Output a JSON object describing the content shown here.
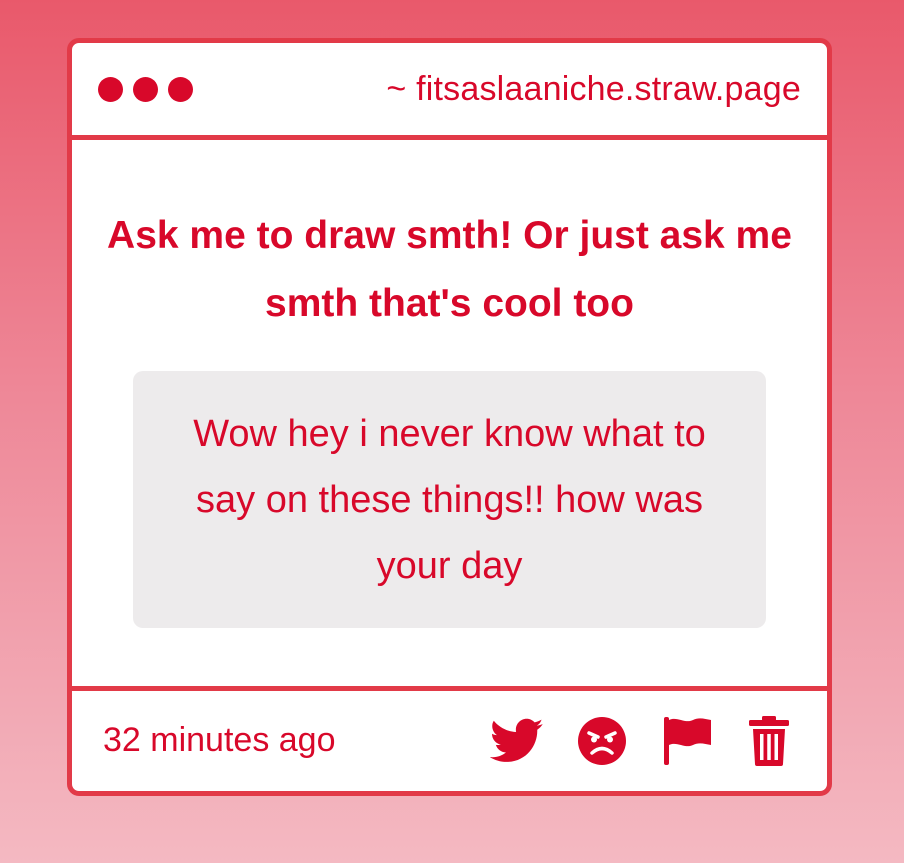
{
  "window": {
    "url": "~ fitsaslaaniche.straw.page"
  },
  "question": {
    "prompt": "Ask me to draw smth! Or just ask me smth that's cool too",
    "message": "Wow hey i never know what to say on these things!! how was your day"
  },
  "footer": {
    "timestamp": "32 minutes ago",
    "actions": [
      {
        "icon": "twitter-icon"
      },
      {
        "icon": "angry-face-icon"
      },
      {
        "icon": "flag-icon"
      },
      {
        "icon": "trash-icon"
      }
    ]
  },
  "colors": {
    "accent": "#d8082a",
    "border": "#e23a48",
    "message_bg": "#edebec"
  }
}
